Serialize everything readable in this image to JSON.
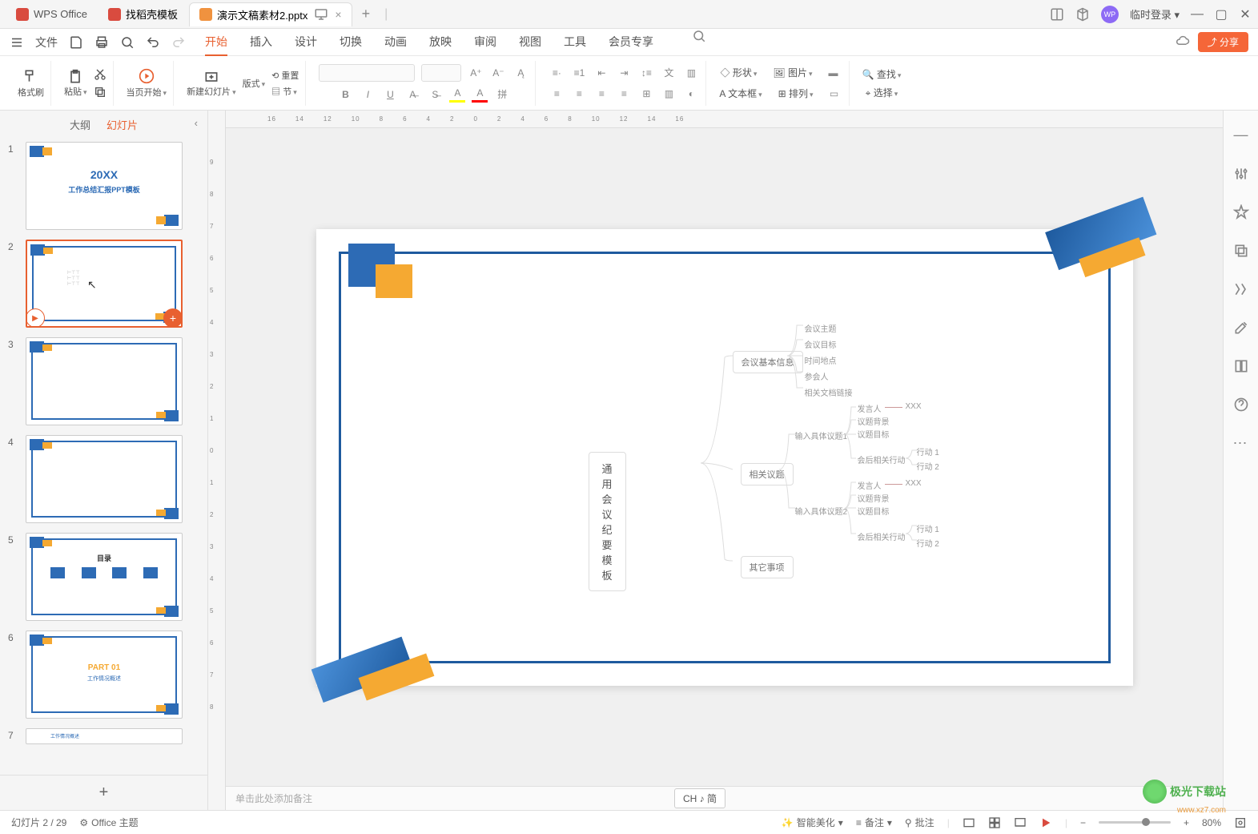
{
  "titleBar": {
    "appName": "WPS Office",
    "tabs": [
      {
        "icon": "red",
        "label": "找稻壳模板"
      },
      {
        "icon": "orange",
        "label": "演示文稿素材2.pptx",
        "active": true,
        "closeable": true
      }
    ],
    "loginLabel": "临时登录"
  },
  "menuBar": {
    "fileLabel": "文件",
    "tabs": [
      "开始",
      "插入",
      "设计",
      "切换",
      "动画",
      "放映",
      "审阅",
      "视图",
      "工具",
      "会员专享"
    ],
    "activeTab": "开始",
    "shareLabel": "分享"
  },
  "ribbon": {
    "formatBrush": "格式刷",
    "paste": "粘贴",
    "startFrom": "当页开始",
    "newSlide": "新建幻灯片",
    "format": "版式",
    "reset": "重置",
    "section": "节",
    "shape": "形状",
    "image": "图片",
    "textbox": "文本框",
    "arrange": "排列",
    "find": "查找",
    "select": "选择"
  },
  "slidePanel": {
    "outlineTab": "大纲",
    "slidesTab": "幻灯片",
    "slides": [
      1,
      2,
      3,
      4,
      5,
      6,
      7
    ],
    "selected": 2,
    "slide1Title": "20XX",
    "slide1Subtitle": "工作总结汇报PPT模板",
    "slide5Title": "目录",
    "slide6Title": "PART 01",
    "slide6Sub": "工作情况概述"
  },
  "mindmap": {
    "root": "通用会议纪要模板",
    "n1": "会议基本信息",
    "n1_children": [
      "会议主题",
      "会议目标",
      "时间地点",
      "参会人",
      "相关文档链接"
    ],
    "n2": "相关议题",
    "n2a": "输入具体议题1",
    "n2b": "输入具体议题2",
    "subLeaves": [
      "发言人",
      "议题背景",
      "议题目标",
      "会后相关行动"
    ],
    "xxx": "XXX",
    "action1": "行动 1",
    "action2": "行动 2",
    "n3": "其它事项"
  },
  "notesBar": {
    "placeholder": "单击此处添加备注",
    "ime": "CH ♪ 简"
  },
  "statusBar": {
    "slideInfo": "幻灯片 2 / 29",
    "theme": "Office 主题",
    "beautify": "智能美化",
    "notes": "备注",
    "comments": "批注",
    "zoom": "80%"
  },
  "watermark": {
    "name": "极光下载站",
    "url": "www.xz7.com"
  },
  "ruler": {
    "marks": [
      "16",
      "14",
      "12",
      "10",
      "8",
      "6",
      "4",
      "2",
      "0",
      "2",
      "4",
      "6",
      "8",
      "10",
      "12",
      "14",
      "16"
    ]
  },
  "colors": {
    "accent": "#e86030",
    "brandBlue": "#2d6bb5",
    "brandYellow": "#f5a932"
  }
}
